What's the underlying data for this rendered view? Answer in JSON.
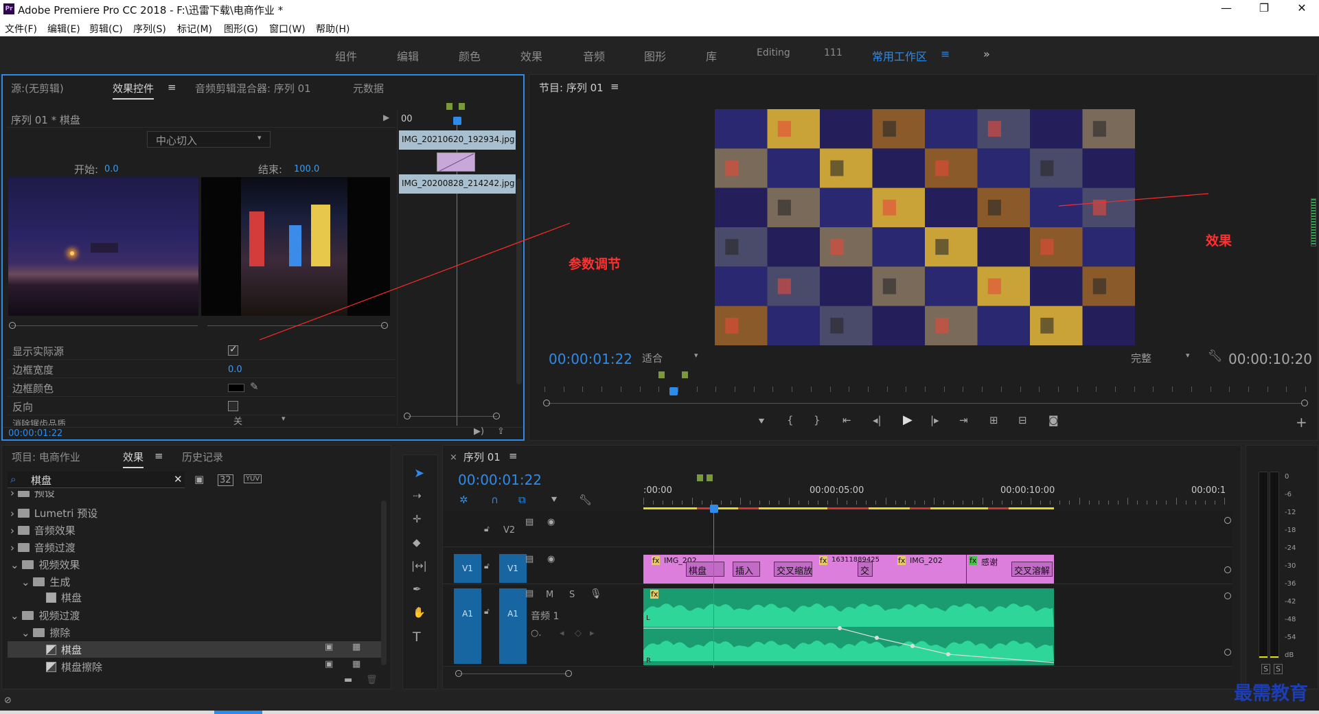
{
  "window": {
    "title": "Adobe Premiere Pro CC 2018 - F:\\迅雷下载\\电商作业 *",
    "logo": "Pr",
    "min": "—",
    "max": "❐",
    "close": "✕"
  },
  "menu": [
    "文件(F)",
    "编辑(E)",
    "剪辑(C)",
    "序列(S)",
    "标记(M)",
    "图形(G)",
    "窗口(W)",
    "帮助(H)"
  ],
  "workspaces": [
    "组件",
    "编辑",
    "颜色",
    "效果",
    "音频",
    "图形",
    "库",
    "Editing",
    "111",
    "常用工作区"
  ],
  "workspace_more": "»",
  "effect_controls": {
    "tabs": [
      "源:(无剪辑)",
      "效果控件",
      "音频剪辑混合器: 序列 01",
      "元数据"
    ],
    "clip_label": "序列 01 * 棋盘",
    "dropdown": "中心切入",
    "start_label": "开始:",
    "start_value": "0.0",
    "end_label": "结束:",
    "end_value": "100.0",
    "props": [
      {
        "label": "显示实际源",
        "type": "check",
        "checked": true
      },
      {
        "label": "边框宽度",
        "type": "value",
        "value": "0.0"
      },
      {
        "label": "边框颜色",
        "type": "color"
      },
      {
        "label": "反向",
        "type": "check",
        "checked": false
      },
      {
        "label": "消除锯齿品质",
        "type": "dropdown",
        "value": "关"
      }
    ],
    "timeline_start": "00",
    "clip_a": "IMG_20210620_192934.jpg",
    "clip_b": "IMG_20200828_214242.jpg",
    "timecode": "00:00:01:22"
  },
  "program": {
    "title": "节目: 序列 01",
    "timecode": "00:00:01:22",
    "fit": "适合",
    "quality": "完整",
    "duration": "00:00:10:20"
  },
  "annotations": {
    "params": "参数调节",
    "effect": "效果"
  },
  "project": {
    "tabs": [
      "项目: 电商作业",
      "效果",
      "历史记录"
    ],
    "search": "棋盘",
    "tree": [
      {
        "label": "预设",
        "level": 0
      },
      {
        "label": "Lumetri 预设",
        "level": 0
      },
      {
        "label": "音频效果",
        "level": 0
      },
      {
        "label": "音频过渡",
        "level": 0
      },
      {
        "label": "视频效果",
        "level": 0
      },
      {
        "label": "生成",
        "level": 1
      },
      {
        "label": "棋盘",
        "level": 2
      },
      {
        "label": "视频过渡",
        "level": 0
      },
      {
        "label": "擦除",
        "level": 1
      },
      {
        "label": "棋盘",
        "level": 2
      },
      {
        "label": "棋盘擦除",
        "level": 2
      }
    ],
    "badges": [
      "32",
      "YUV"
    ]
  },
  "timeline": {
    "tab": "序列 01",
    "timecode": "00:00:01:22",
    "ruler": [
      ":00:00",
      "00:00:05:00",
      "00:00:10:00",
      "00:00:1"
    ],
    "tracks": {
      "v2": "V2",
      "v1": "V1",
      "a1": "A1",
      "audio_name": "音频 1",
      "m": "M",
      "s": "S"
    },
    "clips": [
      "IMG_202",
      "棋盘",
      "插入",
      "交叉缩放",
      "16311889425",
      "交",
      "IMG_202",
      "感谢",
      "交叉溶解"
    ],
    "fx": "fx"
  },
  "meter": {
    "scale": [
      "0",
      "-6",
      "-12",
      "-18",
      "-24",
      "-30",
      "-36",
      "-42",
      "-48",
      "-54",
      "dB"
    ],
    "solo": [
      "S",
      "S"
    ]
  },
  "watermark": "最需教育"
}
